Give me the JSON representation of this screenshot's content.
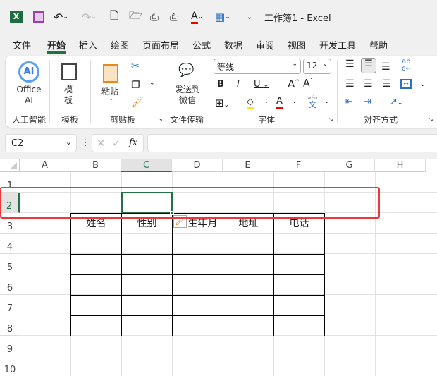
{
  "title": "工作簿1  -  Excel",
  "tabs": [
    "文件",
    "开始",
    "插入",
    "绘图",
    "页面布局",
    "公式",
    "数据",
    "审阅",
    "视图",
    "开发工具",
    "帮助"
  ],
  "ribbon": {
    "office_ai": "Office AI",
    "template_btn": "模板",
    "paste": "粘贴",
    "send_wechat": "发送到微信",
    "groups": [
      "人工智能",
      "模板",
      "剪贴板",
      "文件传输",
      "字体",
      "对齐方式"
    ],
    "font_name": "等线",
    "font_size": "12",
    "phonetic": "wén"
  },
  "name_box": "C2",
  "fx": "fx",
  "columns": [
    "A",
    "B",
    "C",
    "D",
    "E",
    "F",
    "G",
    "H"
  ],
  "rows": [
    "1",
    "2",
    "3",
    "4",
    "5",
    "6",
    "7",
    "8",
    "9",
    "10"
  ],
  "table_headers": [
    "姓名",
    "性别",
    "出生年月",
    "地址",
    "电话"
  ],
  "colors": {
    "accent": "#217346",
    "highlight_box": "#e83a3a"
  }
}
